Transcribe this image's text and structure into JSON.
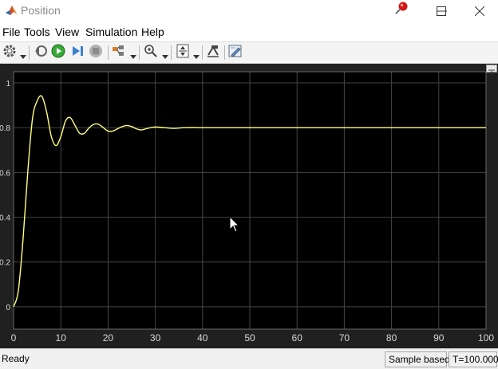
{
  "window": {
    "title": "Position",
    "icons": [
      "matlab-icon",
      "pin-icon",
      "minimize-icon",
      "maximize-icon",
      "close-icon"
    ]
  },
  "menu": {
    "items": [
      "File",
      "Tools",
      "View",
      "Simulation",
      "Help"
    ]
  },
  "toolbar": {
    "icons": [
      "settings-icon",
      "step-back-icon",
      "run-icon",
      "step-forward-icon",
      "stop-icon",
      "highlight-icon",
      "zoom-icon",
      "scale-axes-icon",
      "signal-select-icon",
      "edit-icon"
    ]
  },
  "colors": {
    "plot_background": "#000000",
    "axes_frame": "#202020",
    "grid": "#444444",
    "signal": "#ffff80",
    "tick_text": "#d8d8d8"
  },
  "chart_data": {
    "type": "line",
    "title": "",
    "xlabel": "",
    "ylabel": "",
    "xlim": [
      0,
      100
    ],
    "ylim": [
      -0.1,
      1.05
    ],
    "xticks": [
      0,
      10,
      20,
      30,
      40,
      50,
      60,
      70,
      80,
      90,
      100
    ],
    "yticks": [
      0,
      0.2,
      0.4,
      0.6,
      0.8,
      1
    ],
    "ytick_labels": [
      "0",
      "0.2",
      "0.4",
      "0.6",
      "0.8",
      "1"
    ],
    "grid": true,
    "series": [
      {
        "x": [
          0,
          1,
          2,
          3,
          4,
          5,
          6,
          7,
          8,
          9,
          10,
          11,
          12,
          13,
          14,
          15,
          16,
          17,
          18,
          19,
          20,
          21,
          22,
          23,
          24,
          25,
          26,
          27,
          28,
          29,
          30,
          32,
          34,
          36,
          38,
          40,
          45,
          50,
          60,
          70,
          80,
          90,
          100
        ],
        "values": [
          0.0,
          0.07,
          0.3,
          0.6,
          0.84,
          0.92,
          0.94,
          0.87,
          0.76,
          0.72,
          0.76,
          0.83,
          0.845,
          0.81,
          0.775,
          0.775,
          0.8,
          0.815,
          0.815,
          0.8,
          0.785,
          0.785,
          0.795,
          0.805,
          0.81,
          0.805,
          0.795,
          0.79,
          0.795,
          0.8,
          0.803,
          0.8,
          0.797,
          0.8,
          0.801,
          0.8,
          0.8,
          0.8,
          0.8,
          0.8,
          0.8,
          0.8,
          0.8
        ]
      }
    ]
  },
  "status": {
    "ready": "Ready",
    "mode": "Sample based",
    "time": "T=100.000"
  }
}
